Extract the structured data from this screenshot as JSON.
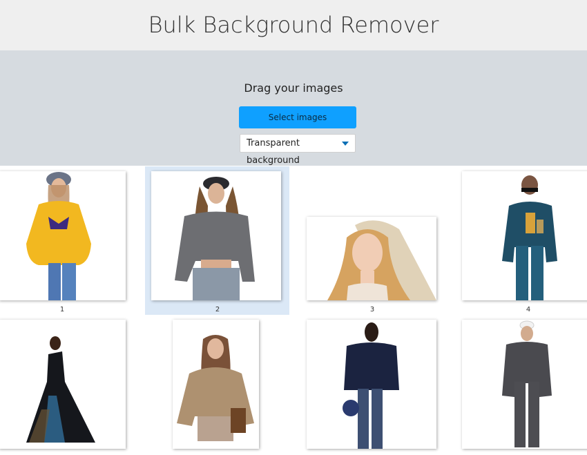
{
  "header": {
    "title": "Bulk Background Remover"
  },
  "dropzone": {
    "prompt": "Drag your images",
    "select_button": "Select images",
    "background_option": "Transparent background"
  },
  "gallery": {
    "selected_index": 2,
    "items": [
      {
        "label": "1",
        "subject": "yellow-sweatshirt-model"
      },
      {
        "label": "2",
        "subject": "grey-sweater-model"
      },
      {
        "label": "3",
        "subject": "bride-with-veil"
      },
      {
        "label": "4",
        "subject": "colorblock-suit-model"
      },
      {
        "label": "",
        "subject": "black-gown-model"
      },
      {
        "label": "",
        "subject": "knit-cardigan-model"
      },
      {
        "label": "",
        "subject": "navy-cardigan-model"
      },
      {
        "label": "",
        "subject": "grey-suit-model"
      }
    ]
  },
  "colors": {
    "header_bg": "#efefef",
    "dropzone_bg": "#d6dbe0",
    "button_bg": "#0fa0ff",
    "selection_bg": "#dbe8f6",
    "caret": "#0a6fb5"
  }
}
